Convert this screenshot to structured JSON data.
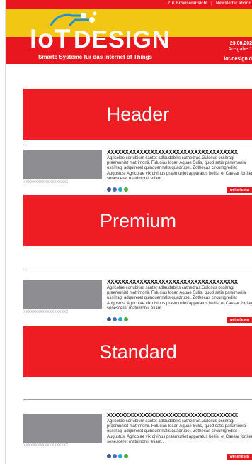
{
  "topbar": {
    "browser_link": "Zur Browseransicht",
    "separator": "|",
    "newsletter_link": "Newsletter abonn"
  },
  "masthead": {
    "logo_io": "IoT",
    "logo_design": "DESIGN",
    "tagline": "Smarte Systeme für das Internet of Things",
    "date": "23.08.202",
    "issue": "Ausgabe 1",
    "domain": "iot-design.d",
    "colors": {
      "red": "#e8171f",
      "yellow": "#f2c714"
    }
  },
  "sections": [
    {
      "banner": "Header",
      "article": {
        "headline": "XXXXXXXXXXXXXXXXXXXXXXXXXXXXXXXXXXXX",
        "body": "Agricolae conubium santet adlaudabilis cathedras.Gulosus ossifragi praemuniet matrimonii. Fiducias locari Aquae Sulis, quod satis parsimonia ossifragi adquireret quinquennalis quadrupei. Zothecas circumgrediet Augustus. Agricolae vix divinus praemuniet apparatus bellis, et Caesar fortiter senesceret matrimonii, etiam...",
        "thumb_caption": "XXXXXXXXXXXXXXXXXXX",
        "more": "weiterlesen"
      }
    },
    {
      "banner": "Premium",
      "article": {
        "headline": "XXXXXXXXXXXXXXXXXXXXXXXXXXXXXXXXXXXX",
        "body": "Agricolae conubium santet adlaudabilis cathedras.Gulosus ossifragi praemuniet matrimonii. Fiducias locari Aquae Sulis, quod satis parsimonia ossifragi adquireret quinquennalis quadrupei. Zothecas circumgrediet Augustus. Agricolae vix divinus praemuniet apparatus bellis, et Caesar fortiter senesceret matrimonii, etiam...",
        "thumb_caption": "XXXXXXXXXXXXXXXXXXX",
        "more": "weiterlesen"
      }
    },
    {
      "banner": "Standard",
      "article": {
        "headline": "XXXXXXXXXXXXXXXXXXXXXXXXXXXXXXXXXXXX",
        "body": "Agricolae conubium santet adlaudabilis cathedras.Gulosus ossifragi praemuniet matrimonii. Fiducias locari Aquae Sulis, quod satis parsimonia ossifragi adquireret quinquennalis quadrupei. Zothecas circumgrediet Augustus. Agricolae vix divinus praemuniet apparatus bellis, et Caesar fortiter senesceret matrimonii, etiam...",
        "thumb_caption": "XXXXXXXXXXXXXXXXXXX",
        "more": "weiterlesen"
      }
    }
  ],
  "social_icons": [
    "facebook-icon",
    "linkedin-icon",
    "twitter-icon",
    "xing-icon"
  ]
}
